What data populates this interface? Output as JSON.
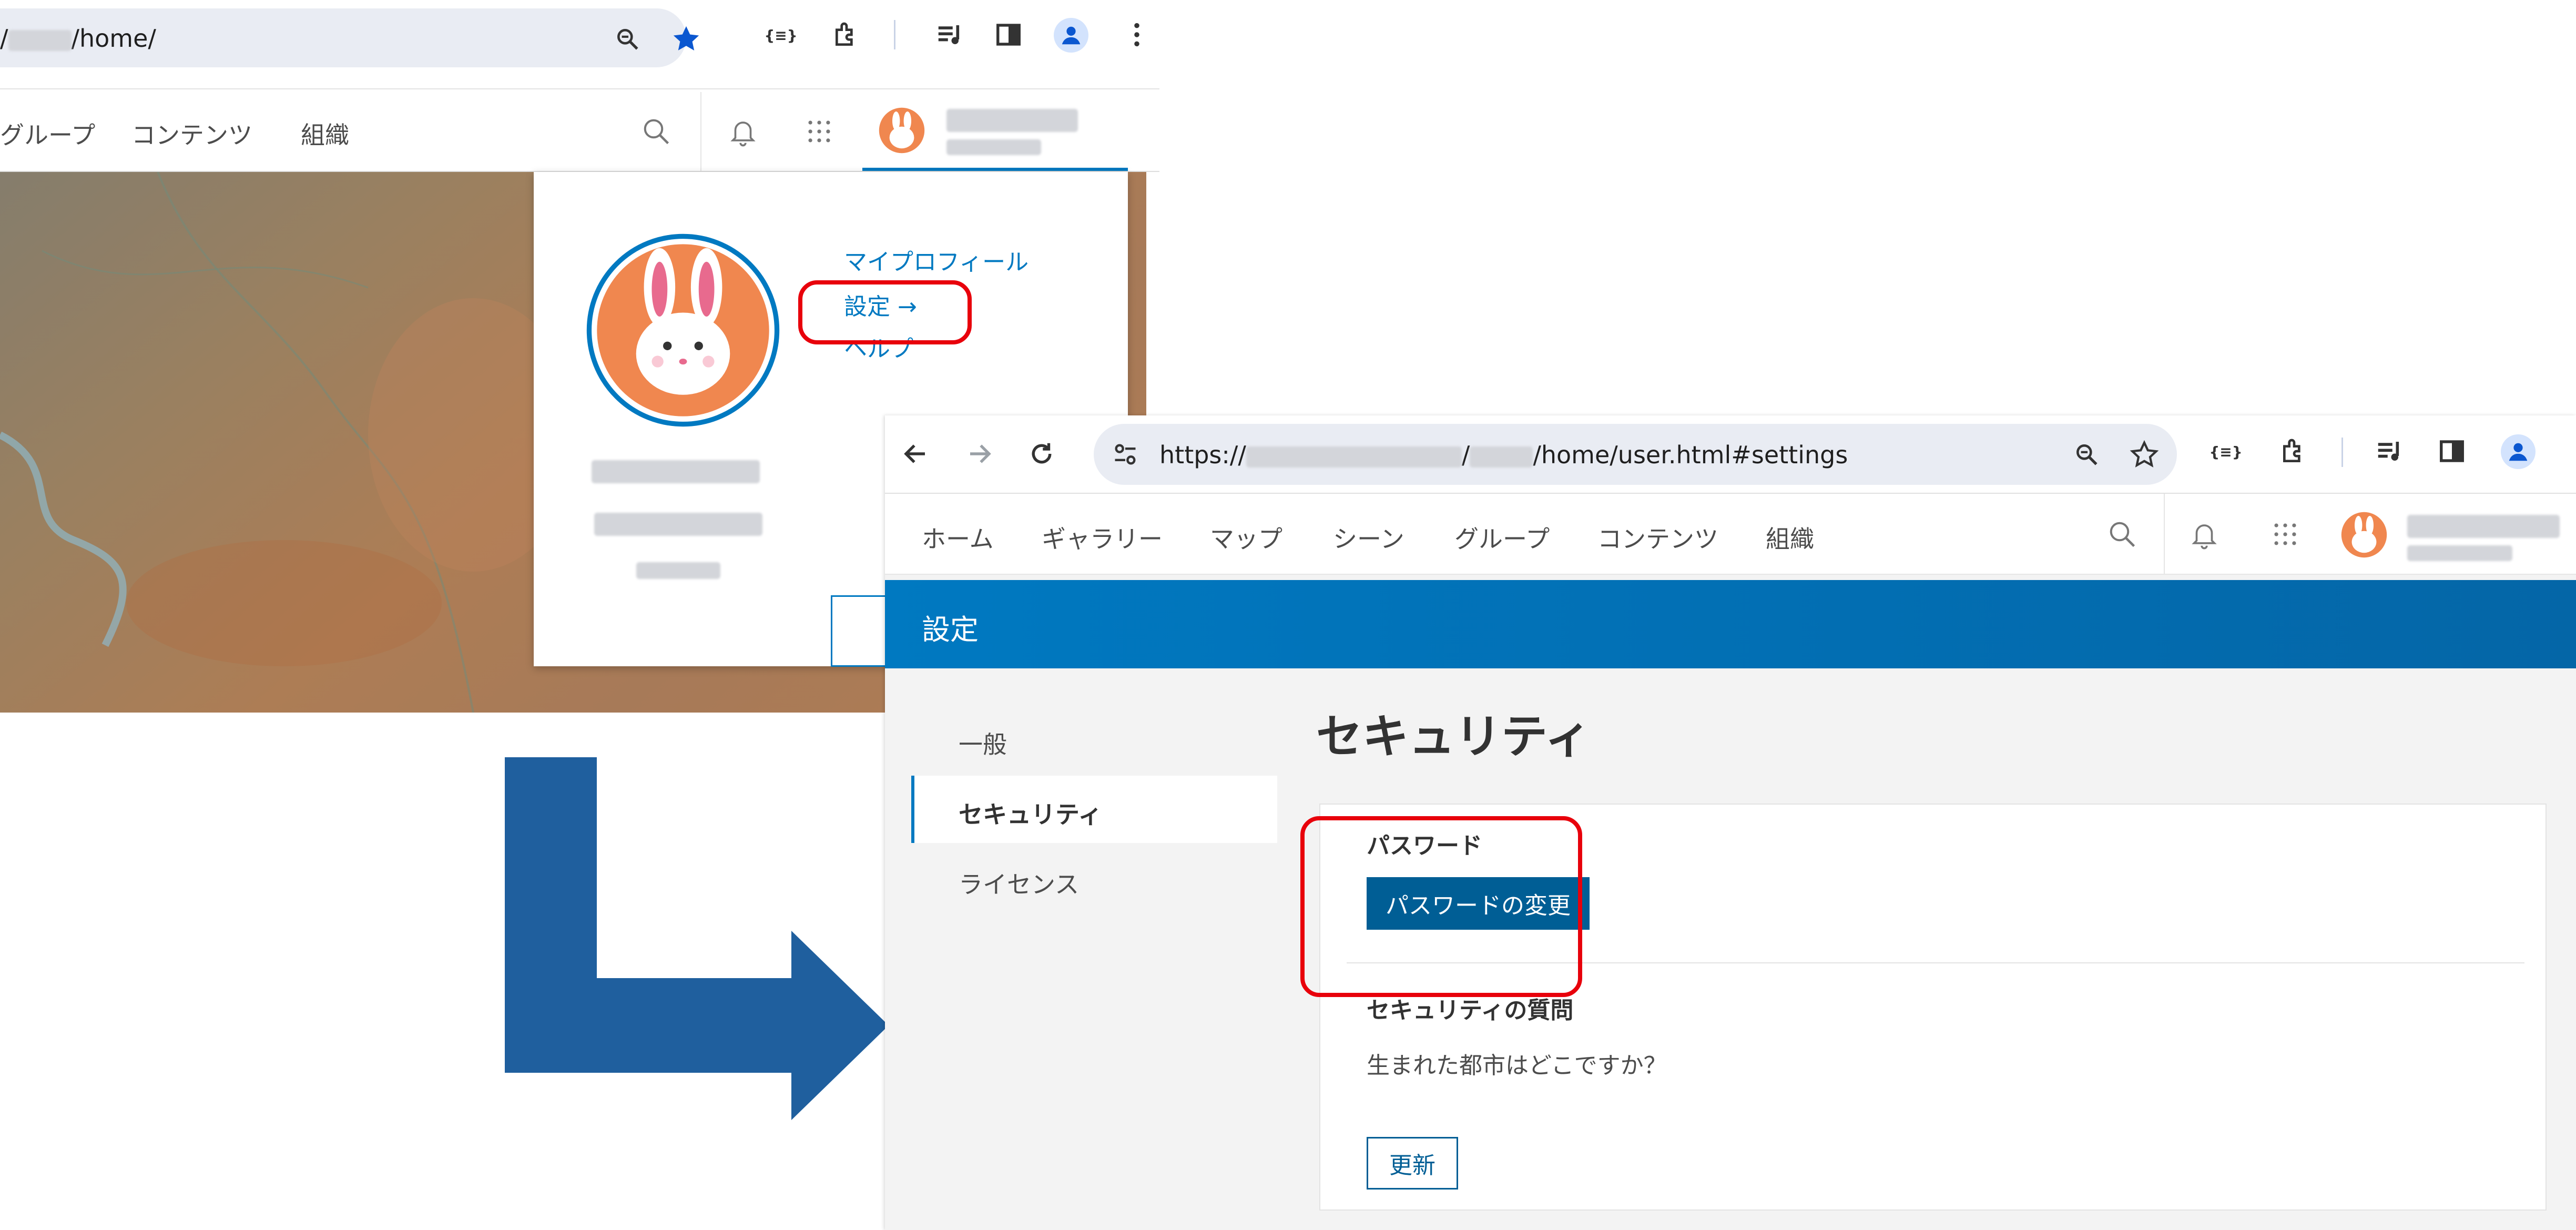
{
  "top_browser": {
    "url_prefix": "/",
    "url_suffix": "/home/",
    "nav": [
      "グループ",
      "コンテンツ",
      "組織"
    ]
  },
  "user_menu": {
    "links": [
      "マイプロフィール",
      "設定 →",
      "ヘルプ"
    ]
  },
  "bottom_browser": {
    "url": {
      "scheme": "https://",
      "sep": "/",
      "path": "/home/user.html#settings"
    },
    "nav": [
      "ホーム",
      "ギャラリー",
      "マップ",
      "シーン",
      "グループ",
      "コンテンツ",
      "組織"
    ],
    "banner_title": "設定",
    "sidebar": [
      "一般",
      "セキュリティ",
      "ライセンス"
    ],
    "section_title": "セキュリティ",
    "password": {
      "label": "パスワード",
      "button": "パスワードの変更"
    },
    "security_question": {
      "label": "セキュリティの質問",
      "question": "生まれた都市はどこですか？",
      "button": "更新"
    }
  },
  "colors": {
    "accent": "#0079c1",
    "button": "#005e95",
    "highlight": "#e8000b",
    "arrow": "#1f5f9e"
  }
}
